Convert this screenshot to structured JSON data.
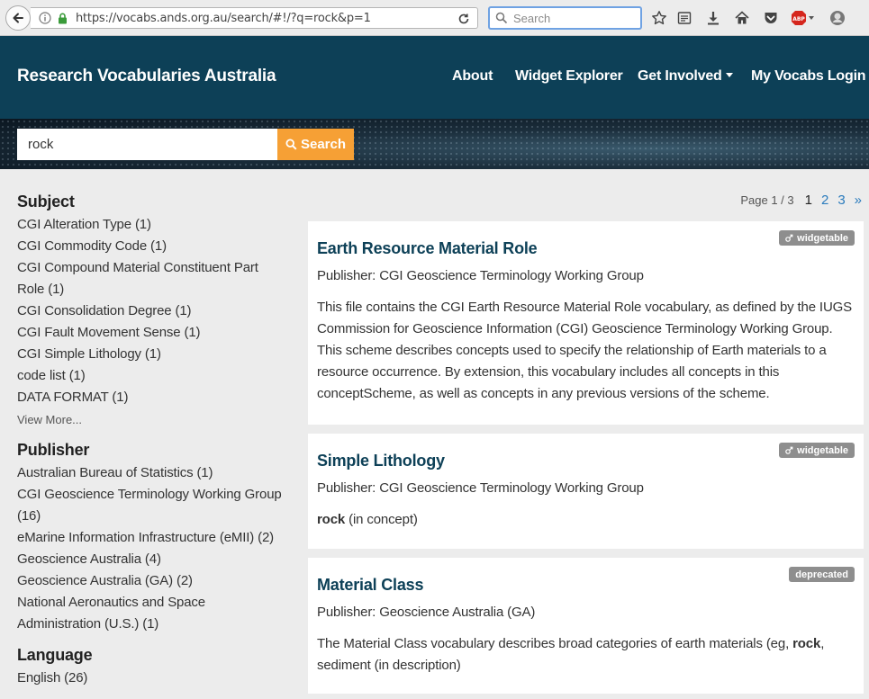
{
  "browser": {
    "url": "https://vocabs.ands.org.au/search/#!/?q=rock&p=1",
    "search_placeholder": "Search"
  },
  "site": {
    "brand": "Research Vocabularies Australia",
    "nav": {
      "about": "About",
      "widget_explorer": "Widget Explorer",
      "get_involved": "Get Involved",
      "login": "My Vocabs Login"
    }
  },
  "search": {
    "query": "rock",
    "button_label": "Search"
  },
  "facets": {
    "subject": {
      "title": "Subject",
      "items": [
        "CGI Alteration Type (1)",
        "CGI Commodity Code (1)",
        "CGI Compound Material Constituent Part Role (1)",
        "CGI Consolidation Degree (1)",
        "CGI Fault Movement Sense (1)",
        "CGI Simple Lithology (1)",
        "code list (1)",
        "DATA FORMAT (1)"
      ],
      "view_more": "View More..."
    },
    "publisher": {
      "title": "Publisher",
      "items": [
        "Australian Bureau of Statistics (1)",
        "CGI Geoscience Terminology Working Group (16)",
        "eMarine Information Infrastructure (eMII) (2)",
        "Geoscience Australia (4)",
        "Geoscience Australia (GA) (2)",
        "National Aeronautics and Space Administration (U.S.) (1)"
      ]
    },
    "language": {
      "title": "Language",
      "items": [
        "English (26)"
      ]
    }
  },
  "pagination": {
    "label": "Page 1 / 3",
    "pages": [
      "1",
      "2",
      "3"
    ],
    "next": "»"
  },
  "results": [
    {
      "title": "Earth Resource Material Role",
      "publisher": "Publisher: CGI Geoscience Terminology Working Group",
      "badge": "widgetable",
      "description": "This file contains the CGI Earth Resource Material Role vocabulary, as defined by the IUGS Commission for Geoscience Information (CGI) Geoscience Terminology Working Group. This scheme describes concepts used to specify the relationship of Earth materials to a resource occurrence. By extension, this vocabulary includes all concepts in this conceptScheme, as well as concepts in any previous versions of the scheme."
    },
    {
      "title": "Simple Lithology",
      "publisher": "Publisher: CGI Geoscience Terminology Working Group",
      "badge": "widgetable",
      "match_term": "rock",
      "match_context": " (in concept)"
    },
    {
      "title": "Material Class",
      "publisher": "Publisher: Geoscience Australia (GA)",
      "badge": "deprecated",
      "desc_before": "The Material Class vocabulary describes broad categories of earth materials (eg, ",
      "desc_bold": "rock",
      "desc_after": ", sediment (in description)"
    }
  ],
  "colors": {
    "header": "#0d4057",
    "accent": "#f6a035",
    "link": "#2a7bbd",
    "badge": "#8e8e8e"
  }
}
